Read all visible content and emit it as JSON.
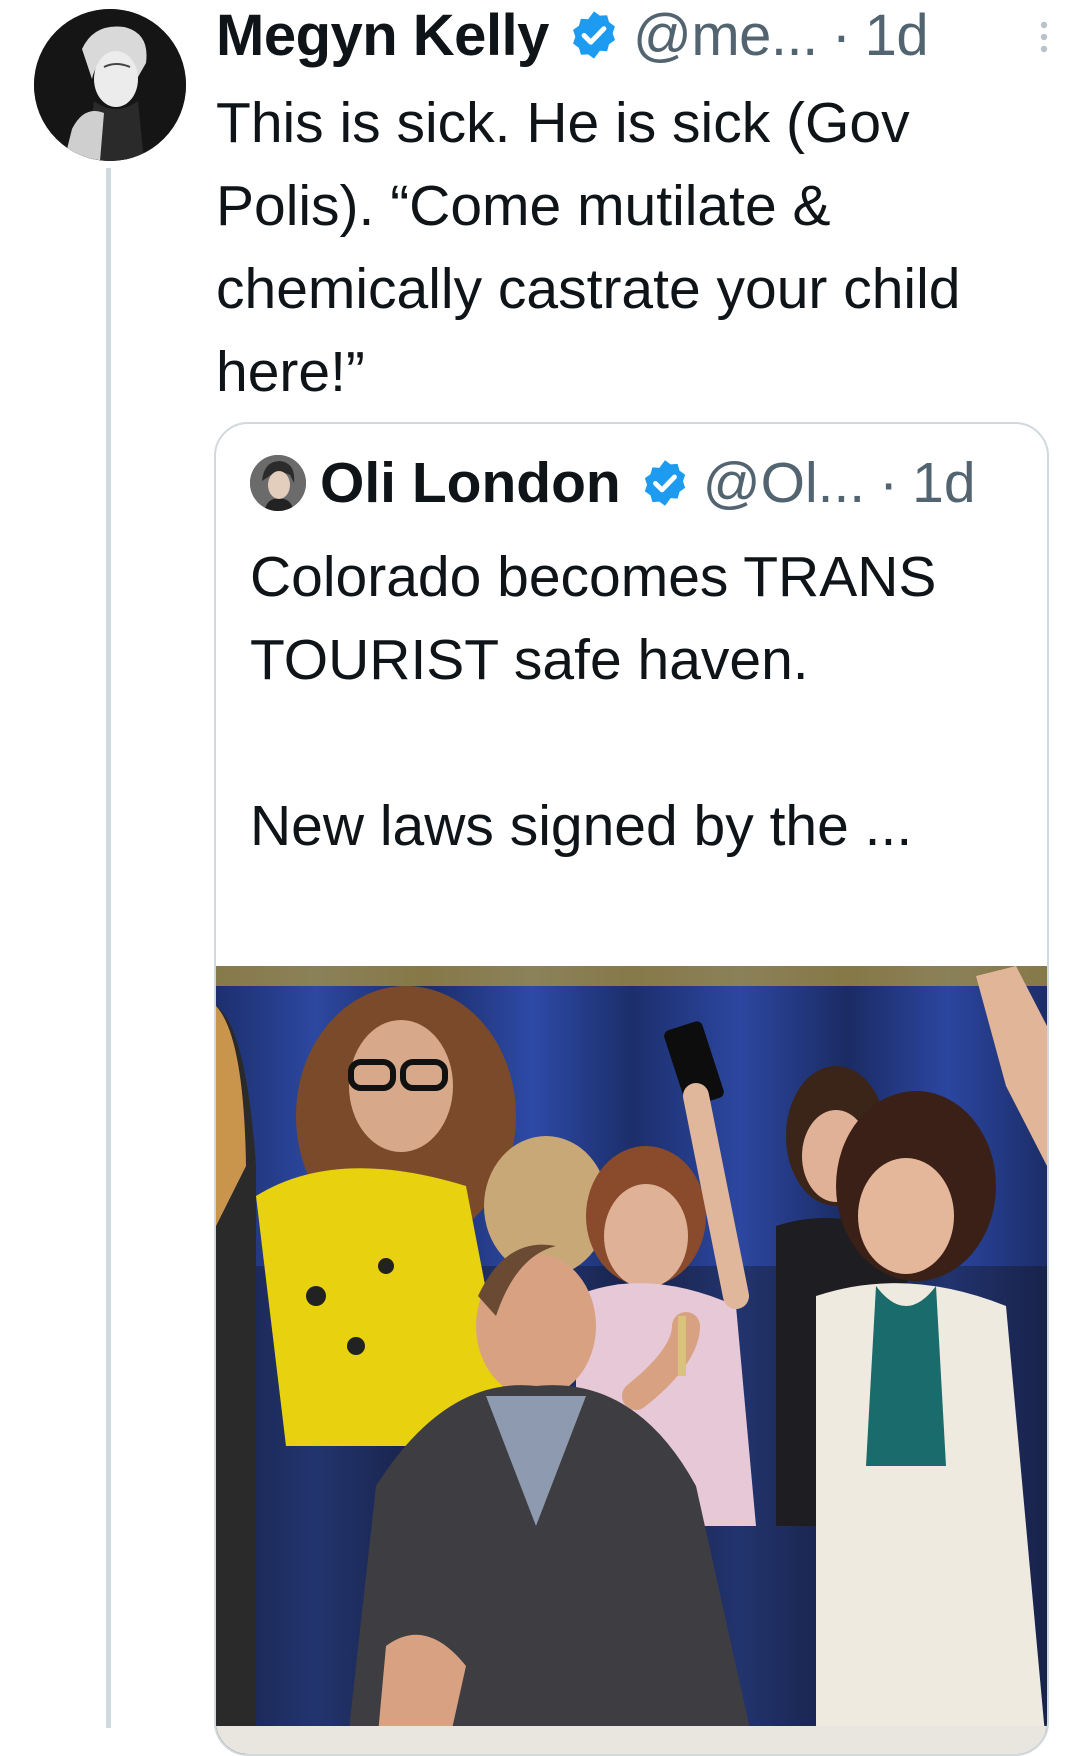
{
  "tweet": {
    "author_name": "Megyn Kelly",
    "handle": "@me...",
    "separator": "·",
    "time": "1d",
    "text": "This is sick. He is sick (Gov Polis). “Come mutilate & chemically castrate your child here!”",
    "icons": {
      "verified": "verified-badge-icon",
      "more": "more-options-icon"
    }
  },
  "quote": {
    "author_name": "Oli London",
    "handle": "@Ol...",
    "separator": "·",
    "time": "1d",
    "text": "Colorado becomes TRANS TOURIST safe haven.\n\nNew laws signed by the ..."
  },
  "colors": {
    "verified_blue": "#1d9bf0",
    "secondary_text": "#536471",
    "border": "#cfd9de",
    "curtain_blue": "#1f3a8a",
    "yellow_top": "#f1d916"
  }
}
